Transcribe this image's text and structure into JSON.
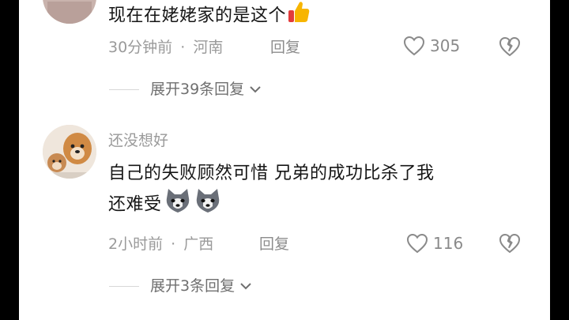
{
  "comments": [
    {
      "text": "现在在姥姥家的是这个",
      "emoji": "thumbs-up",
      "time": "30分钟前",
      "dot": "·",
      "location": "河南",
      "reply_label": "回复",
      "likes": "305",
      "expand_label": "展开39条回复"
    },
    {
      "username": "还没想好",
      "text_line1": "自己的失败顾然可惜   兄弟的成功比杀了我",
      "text_line2": "还难受",
      "emoji": "husky-dog",
      "time": "2小时前",
      "dot": "·",
      "location": "广西",
      "reply_label": "回复",
      "likes": "116",
      "expand_label": "展开3条回复"
    }
  ],
  "colors": {
    "text": "#161616",
    "meta": "#9a9a9a",
    "background": "#ffffff"
  }
}
